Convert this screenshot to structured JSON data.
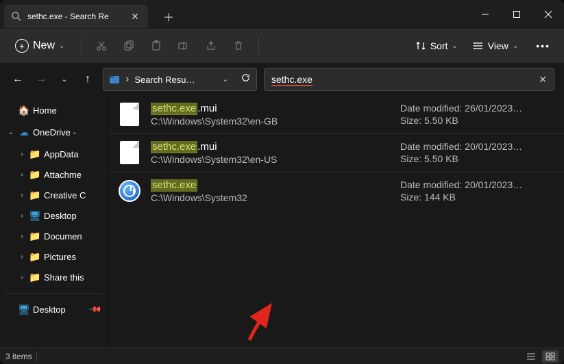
{
  "window": {
    "tab_title": "sethc.exe - Search Re"
  },
  "toolbar": {
    "new_label": "New",
    "sort_label": "Sort",
    "view_label": "View"
  },
  "address": {
    "breadcrumb": "Search Resu…"
  },
  "search": {
    "query": "sethc.exe"
  },
  "sidebar": {
    "home": "Home",
    "onedrive": "OneDrive -",
    "items": [
      "AppData",
      "Attachme",
      "Creative C",
      "Desktop",
      "Documen",
      "Pictures",
      "Share this"
    ],
    "pinned": "Desktop"
  },
  "results": [
    {
      "hl": "sethc.exe",
      "rest": ".mui",
      "path": "C:\\Windows\\System32\\en-GB",
      "date": "Date modified: 26/01/2023…",
      "size": "Size: 5.50 KB",
      "icon": "file"
    },
    {
      "hl": "sethc.exe",
      "rest": ".mui",
      "path": "C:\\Windows\\System32\\en-US",
      "date": "Date modified: 20/01/2023…",
      "size": "Size: 5.50 KB",
      "icon": "file"
    },
    {
      "hl": "sethc.exe",
      "rest": "",
      "path": "C:\\Windows\\System32",
      "date": "Date modified: 20/01/2023…",
      "size": "Size: 144 KB",
      "icon": "app"
    }
  ],
  "status": {
    "count": "3 items"
  }
}
